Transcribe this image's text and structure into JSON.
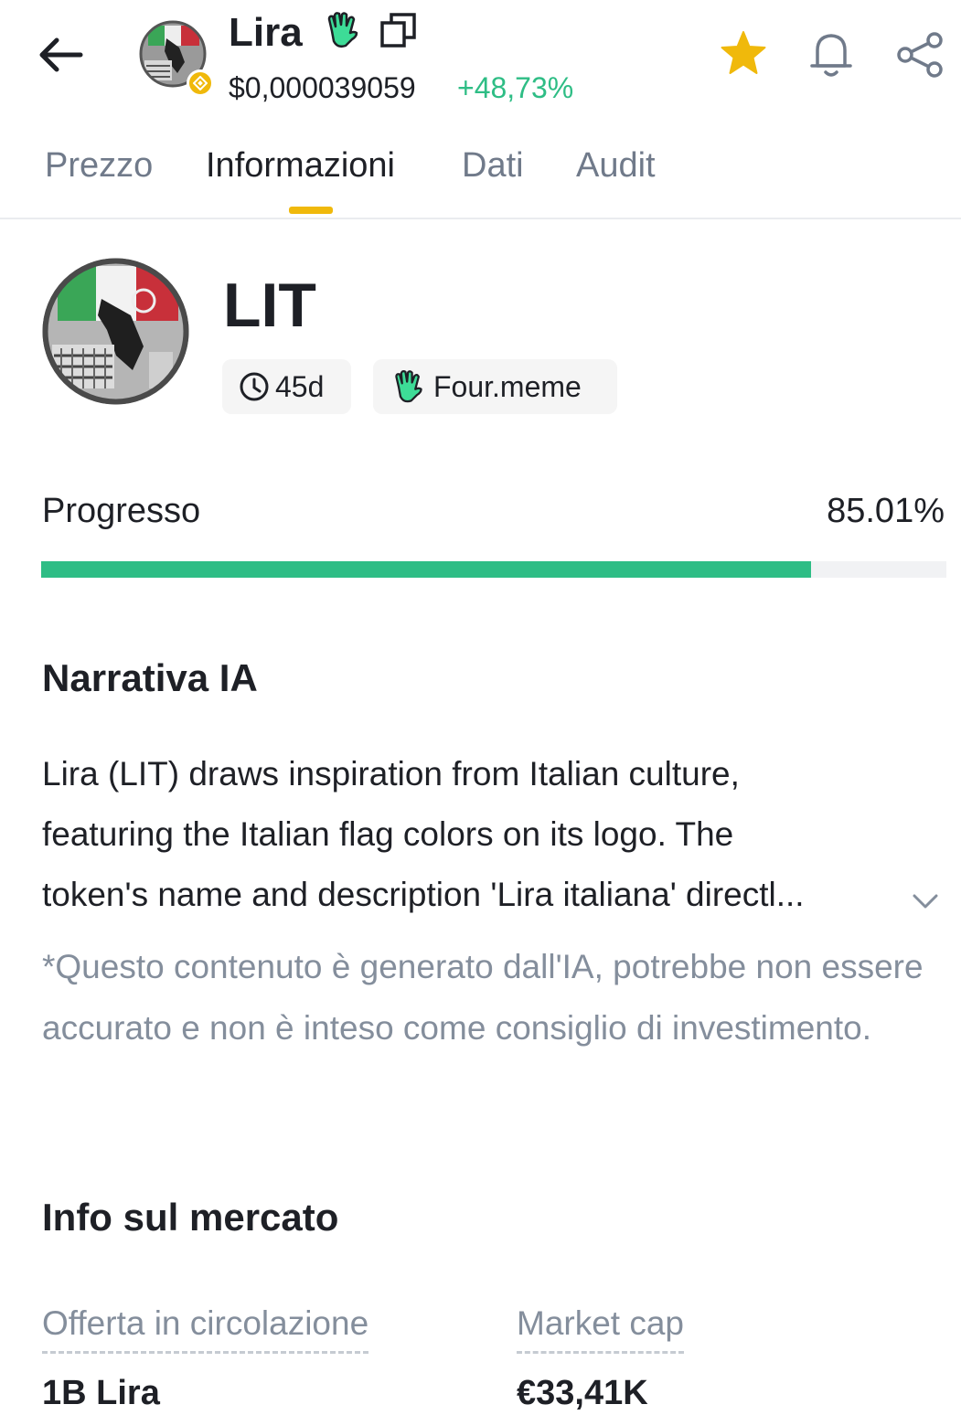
{
  "header": {
    "token_name": "Lira",
    "price": "$0,000039059",
    "change": "+48,73%",
    "icons": [
      "back-arrow-icon",
      "token-logo",
      "bnb-chain-icon",
      "four-meme-hand-icon",
      "copy-icon",
      "star-icon",
      "bell-icon",
      "share-icon"
    ]
  },
  "tabs": [
    {
      "label": "Prezzo",
      "active": false
    },
    {
      "label": "Informazioni",
      "active": true
    },
    {
      "label": "Dati",
      "active": false
    },
    {
      "label": "Audit",
      "active": false
    }
  ],
  "token": {
    "symbol": "LIT",
    "age": "45d",
    "platform": "Four.meme"
  },
  "progress": {
    "label": "Progresso",
    "value_text": "85.01%",
    "value": 85.01
  },
  "narrative": {
    "title": "Narrativa IA",
    "lines": [
      "Lira (LIT) draws inspiration from Italian culture,",
      "featuring the Italian flag colors on its logo. The",
      "token's name and description 'Lira italiana' directl..."
    ],
    "disclaimer": "*Questo contenuto è generato dall'IA, potrebbe non essere accurato e non è inteso come consiglio di investimento."
  },
  "market": {
    "title": "Info sul mercato",
    "circulating_label": "Offerta in circolazione",
    "circulating_value": "1B Lira",
    "marketcap_label": "Market cap",
    "marketcap_value": "€33,41K"
  },
  "colors": {
    "accent": "#f0b90b",
    "positive": "#2ebd85",
    "text": "#1e2026",
    "muted": "#848e9c"
  }
}
